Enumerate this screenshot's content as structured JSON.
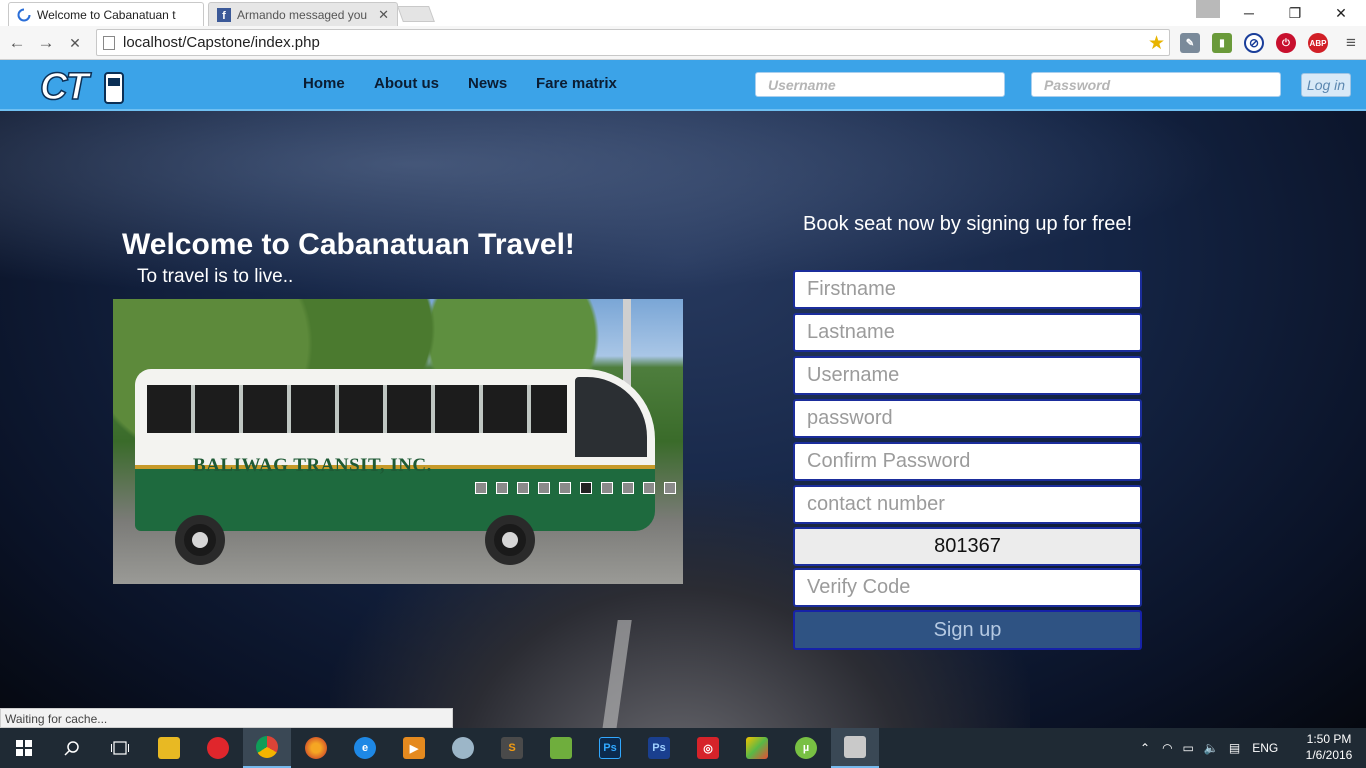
{
  "browser": {
    "tabs": [
      {
        "title": "Welcome to Cabanatuan t",
        "active": true,
        "icon": "loading-spinner-icon"
      },
      {
        "title": "Armando messaged you",
        "active": false,
        "icon": "facebook-icon"
      }
    ],
    "tab_close": "✕",
    "window_controls": {
      "minimize": "─",
      "restore": "❐",
      "close": "✕"
    },
    "nav": {
      "back": "←",
      "forward": "→",
      "stop": "✕"
    },
    "address": "localhost/Capstone/index.php",
    "bookmark_star": "★",
    "extensions": [
      "eyedropper-icon",
      "bookmark-manager-icon",
      "block-icon",
      "shield-badge-icon",
      "adblock-plus-icon"
    ],
    "adblock_label": "ABP",
    "menu": "≡"
  },
  "site": {
    "logo": {
      "text": "CT",
      "icon": "bus-icon"
    },
    "nav": [
      "Home",
      "About us",
      "News",
      "Fare matrix"
    ],
    "login": {
      "username_placeholder": "Username",
      "password_placeholder": "Password",
      "button": "Log in"
    },
    "hero": {
      "title": "Welcome to Cabanatuan Travel!",
      "tagline": "To travel is to live.."
    },
    "slider": {
      "brand": "BALIWAG TRANSIT, INC.",
      "dots": 10,
      "active_dot": 5
    },
    "signup": {
      "title": "Book seat now by signing up for free!",
      "fields": [
        "Firstname",
        "Lastname",
        "Username",
        "password",
        "Confirm Password",
        "contact number"
      ],
      "captcha": "801367",
      "verify_placeholder": "Verify Code",
      "button": "Sign up"
    },
    "status": "Waiting for cache...",
    "colors": {
      "navbar": "#3ba3e8",
      "field_border": "#1b2d9c",
      "signup_button": "#2f5383"
    }
  },
  "taskbar": {
    "start_icon": "windows-logo-icon",
    "apps": [
      "file-explorer-icon",
      "opera-icon",
      "chrome-icon",
      "firefox-icon",
      "internet-explorer-icon",
      "media-player-icon",
      "paint-icon",
      "sublime-text-icon",
      "notepad-icon",
      "photoshop-icon",
      "photoshop-icon",
      "red-app-icon",
      "bluestacks-icon",
      "utorrent-icon",
      "network-drive-icon"
    ],
    "language": "ENG",
    "time": "1:50 PM",
    "date": "1/6/2016"
  }
}
